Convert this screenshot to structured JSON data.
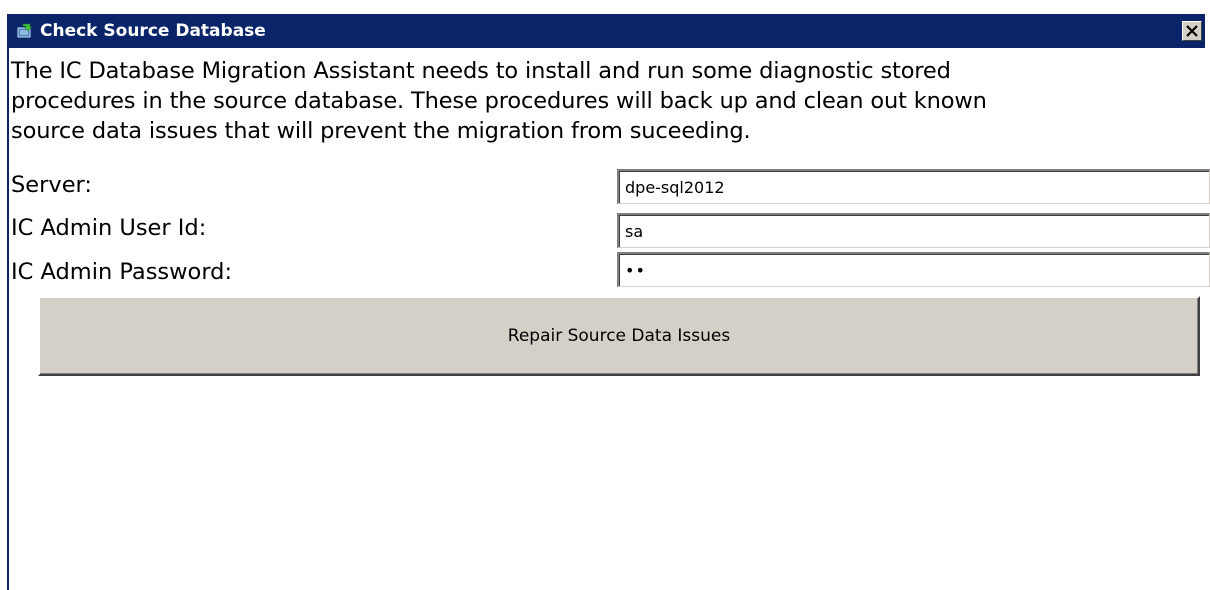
{
  "window": {
    "title": "Check Source Database",
    "icon": "database-check-icon",
    "close_icon": "close-icon"
  },
  "description": "The IC Database Migration Assistant needs to install and run some diagnostic stored\nprocedures in the source database.  These procedures will back up and clean out known\nsource data issues that will prevent the migration from suceeding.",
  "fields": {
    "server": {
      "label": "Server:",
      "value": "dpe-sql2012"
    },
    "user_id": {
      "label": "IC Admin User Id:",
      "value": "sa"
    },
    "password": {
      "label": "IC Admin Password:",
      "value": "xx"
    }
  },
  "repair_button": {
    "label": "Repair Source Data Issues"
  },
  "colors": {
    "titlebar": "#0a246a",
    "button_face": "#d4d0c8",
    "background": "#ffffff"
  }
}
